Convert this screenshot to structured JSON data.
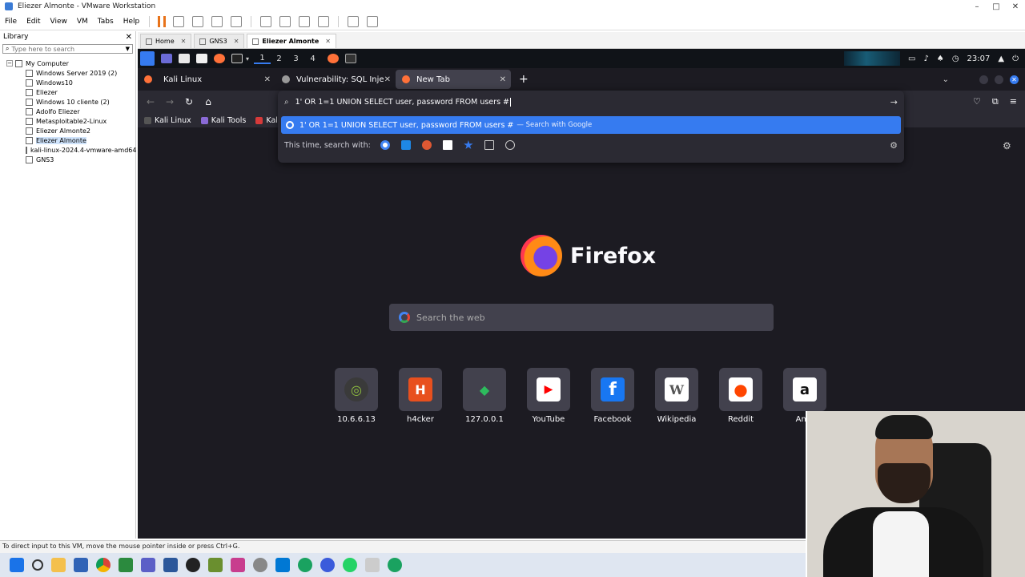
{
  "window": {
    "title": "Eliezer Almonte - VMware Workstation"
  },
  "menu": [
    "File",
    "Edit",
    "View",
    "VM",
    "Tabs",
    "Help"
  ],
  "library": {
    "title": "Library",
    "search_placeholder": "Type here to search",
    "root": "My Computer",
    "items": [
      "Windows Server 2019 (2)",
      "Windows10",
      "Eliezer",
      "Windows 10 cliente (2)",
      "Adolfo Eliezer",
      "Metasploitable2-Linux",
      "Eliezer Almonte2",
      "Eliezer Almonte",
      "kali-linux-2024.4-vmware-amd64",
      "GNS3"
    ],
    "selected_index": 7
  },
  "vm_tabs": [
    {
      "label": "Home",
      "active": false
    },
    {
      "label": "GNS3",
      "active": false
    },
    {
      "label": "Eliezer Almonte",
      "active": true
    }
  ],
  "kali_panel": {
    "workspaces": [
      "1",
      "2",
      "3",
      "4"
    ],
    "active_workspace": "1",
    "clock": "23:07"
  },
  "firefox": {
    "tabs": [
      {
        "label": "Kali Linux",
        "active": false
      },
      {
        "label": "Vulnerability: SQL Injectio",
        "active": false
      },
      {
        "label": "New Tab",
        "active": true
      }
    ],
    "bookmarks": [
      "Kali Linux",
      "Kali Tools",
      "Kali Do"
    ],
    "urlbar": {
      "query": "1' OR 1=1 UNION SELECT user, password FROM users #",
      "suggestion": "1' OR 1=1 UNION SELECT user, password FROM users #",
      "suggestion_action": "— Search with Google",
      "oneoff_label": "This time, search with:"
    },
    "wordmark": "Firefox",
    "search_placeholder": "Search the web",
    "tiles": [
      {
        "label": "10.6.6.13",
        "color": "#3a3a3a",
        "glyph": "◎"
      },
      {
        "label": "h4cker",
        "color": "#e8501e",
        "glyph": "H"
      },
      {
        "label": "127.0.0.1",
        "color": "#2d2d2d",
        "glyph": "◆"
      },
      {
        "label": "YouTube",
        "color": "#ffffff",
        "glyph": "▶"
      },
      {
        "label": "Facebook",
        "color": "#1877f2",
        "glyph": "f"
      },
      {
        "label": "Wikipedia",
        "color": "#ffffff",
        "glyph": "W"
      },
      {
        "label": "Reddit",
        "color": "#ffffff",
        "glyph": "●"
      },
      {
        "label": "Ama",
        "color": "#ffffff",
        "glyph": "a"
      }
    ]
  },
  "statusbar": {
    "text": "To direct input to this VM, move the mouse pointer inside or press Ctrl+G."
  }
}
